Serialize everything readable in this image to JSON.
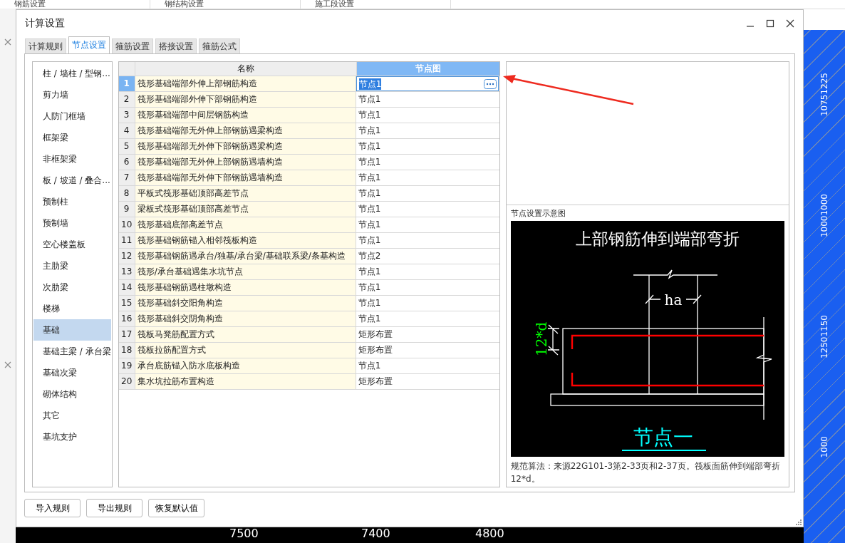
{
  "background_app": {
    "top_tabs": [
      "钢筋设置",
      "钢结构设置",
      "施工段设置"
    ],
    "ruler_labels": [
      "10751225",
      "10001000",
      "12501150",
      "1000"
    ],
    "axis_labels": [
      "7500",
      "7400",
      "4800"
    ]
  },
  "dialog": {
    "title": "计算设置",
    "tabs": [
      {
        "label": "计算规则",
        "selected": false
      },
      {
        "label": "节点设置",
        "selected": true
      },
      {
        "label": "箍筋设置",
        "selected": false
      },
      {
        "label": "搭接设置",
        "selected": false
      },
      {
        "label": "箍筋公式",
        "selected": false
      }
    ],
    "categories": [
      {
        "label": "柱 / 墙柱 / 型钢...",
        "selected": false
      },
      {
        "label": "剪力墙",
        "selected": false
      },
      {
        "label": "人防门框墙",
        "selected": false
      },
      {
        "label": "框架梁",
        "selected": false
      },
      {
        "label": "非框架梁",
        "selected": false
      },
      {
        "label": "板 / 坡道 / 叠合...",
        "selected": false
      },
      {
        "label": "预制柱",
        "selected": false
      },
      {
        "label": "预制墙",
        "selected": false
      },
      {
        "label": "空心楼盖板",
        "selected": false
      },
      {
        "label": "主肋梁",
        "selected": false
      },
      {
        "label": "次肋梁",
        "selected": false
      },
      {
        "label": "楼梯",
        "selected": false
      },
      {
        "label": "基础",
        "selected": true
      },
      {
        "label": "基础主梁 / 承台梁",
        "selected": false
      },
      {
        "label": "基础次梁",
        "selected": false
      },
      {
        "label": "砌体结构",
        "selected": false
      },
      {
        "label": "其它",
        "selected": false
      },
      {
        "label": "基坑支护",
        "selected": false
      }
    ],
    "table": {
      "columns": [
        {
          "label": "名称",
          "selected": false
        },
        {
          "label": "节点图",
          "selected": true
        }
      ],
      "rows": [
        {
          "index": "1",
          "name": "筏形基础端部外伸上部钢筋构造",
          "value": "节点1",
          "selected": true
        },
        {
          "index": "2",
          "name": "筏形基础端部外伸下部钢筋构造",
          "value": "节点1",
          "selected": false
        },
        {
          "index": "3",
          "name": "筏形基础端部中间层钢筋构造",
          "value": "节点1",
          "selected": false
        },
        {
          "index": "4",
          "name": "筏形基础端部无外伸上部钢筋遇梁构造",
          "value": "节点1",
          "selected": false
        },
        {
          "index": "5",
          "name": "筏形基础端部无外伸下部钢筋遇梁构造",
          "value": "节点1",
          "selected": false
        },
        {
          "index": "6",
          "name": "筏形基础端部无外伸上部钢筋遇墙构造",
          "value": "节点1",
          "selected": false
        },
        {
          "index": "7",
          "name": "筏形基础端部无外伸下部钢筋遇墙构造",
          "value": "节点1",
          "selected": false
        },
        {
          "index": "8",
          "name": "平板式筏形基础顶部高差节点",
          "value": "节点1",
          "selected": false
        },
        {
          "index": "9",
          "name": "梁板式筏形基础顶部高差节点",
          "value": "节点1",
          "selected": false
        },
        {
          "index": "10",
          "name": "筏形基础底部高差节点",
          "value": "节点1",
          "selected": false
        },
        {
          "index": "11",
          "name": "筏形基础钢筋锚入相邻筏板构造",
          "value": "节点1",
          "selected": false
        },
        {
          "index": "12",
          "name": "筏形基础钢筋遇承台/独基/承台梁/基础联系梁/条基构造",
          "value": "节点2",
          "selected": false
        },
        {
          "index": "13",
          "name": "筏形/承台基础遇集水坑节点",
          "value": "节点1",
          "selected": false
        },
        {
          "index": "14",
          "name": "筏形基础钢筋遇柱墩构造",
          "value": "节点1",
          "selected": false
        },
        {
          "index": "15",
          "name": "筏形基础斜交阳角构造",
          "value": "节点1",
          "selected": false
        },
        {
          "index": "16",
          "name": "筏形基础斜交阴角构造",
          "value": "节点1",
          "selected": false
        },
        {
          "index": "17",
          "name": "筏板马凳筋配置方式",
          "value": "矩形布置",
          "selected": false
        },
        {
          "index": "18",
          "name": "筏板拉筋配置方式",
          "value": "矩形布置",
          "selected": false
        },
        {
          "index": "19",
          "name": "承台底筋锚入防水底板构造",
          "value": "节点1",
          "selected": false
        },
        {
          "index": "20",
          "name": "集水坑拉筋布置构造",
          "value": "矩形布置",
          "selected": false
        }
      ]
    },
    "preview": {
      "title": "节点设置示意图",
      "diagram": {
        "heading": "上部钢筋伸到端部弯折",
        "dimension_top": "ha",
        "dimension_left": "12*d",
        "caption": "节点一"
      },
      "description": "规范算法：来源22G101-3第2-33页和2-37页。筏板面筋伸到端部弯折12*d。"
    },
    "buttons": [
      "导入规则",
      "导出规则",
      "恢复默认值"
    ]
  }
}
